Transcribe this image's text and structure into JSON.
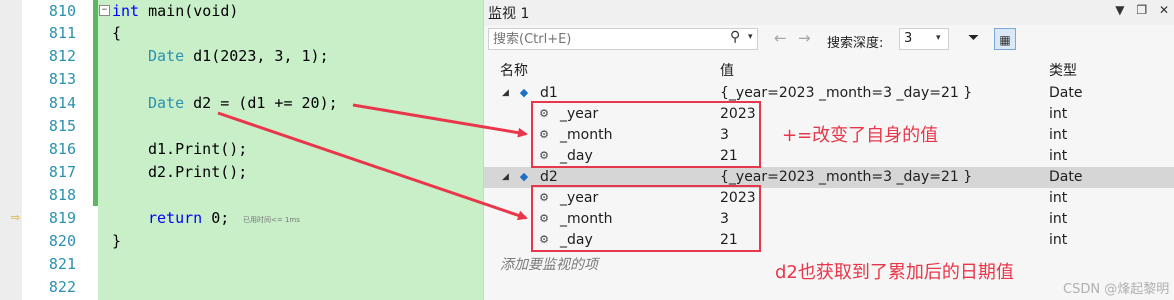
{
  "editor": {
    "line_numbers": [
      "810",
      "811",
      "812",
      "813",
      "814",
      "815",
      "816",
      "817",
      "818",
      "819",
      "820",
      "821",
      "822"
    ],
    "code": {
      "l810_kw": "int",
      "l810_rest": " main(void)",
      "l811": "{",
      "l812_ty": "Date",
      "l812_rest": " d1(2023, 3, 1);",
      "l814_ty": "Date",
      "l814_rest": " d2 = (d1 += 20);",
      "l816": "d1.Print();",
      "l817": "d2.Print();",
      "l819_kw": "return",
      "l819_rest": " 0;",
      "l820": "}"
    },
    "fold_glyph": "−",
    "breakpoint_glyph": "⇨",
    "elapsed": "已用时间<= 1ms"
  },
  "watch": {
    "title": "监视 1",
    "title_buttons": [
      "▼",
      "❐",
      "✕"
    ],
    "search_placeholder": "搜索(Ctrl+E)",
    "depth_label": "搜索深度:",
    "depth_value": "3",
    "columns": {
      "name": "名称",
      "value": "值",
      "type": "类型"
    },
    "rows": [
      {
        "name": "d1",
        "value": "{_year=2023 _month=3 _day=21 }",
        "type": "Date"
      },
      {
        "name": "_year",
        "value": "2023",
        "type": "int"
      },
      {
        "name": "_month",
        "value": "3",
        "type": "int"
      },
      {
        "name": "_day",
        "value": "21",
        "type": "int"
      },
      {
        "name": "d2",
        "value": "{_year=2023 _month=3 _day=21 }",
        "type": "Date"
      },
      {
        "name": "_year",
        "value": "2023",
        "type": "int"
      },
      {
        "name": "_month",
        "value": "3",
        "type": "int"
      },
      {
        "name": "_day",
        "value": "21",
        "type": "int"
      }
    ],
    "add_item": "添加要监视的项",
    "selected_row": "d2"
  },
  "annotations": {
    "note1": "+=改变了自身的值",
    "note2": "d2也获取到了累加后的日期值",
    "color": "#e8374a"
  },
  "credit": "CSDN @烽起黎明"
}
